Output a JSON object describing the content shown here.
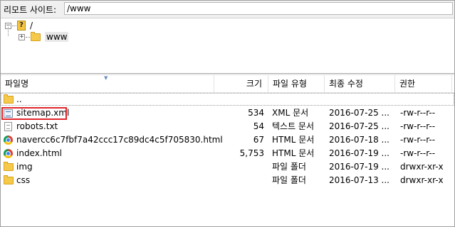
{
  "remote_site": {
    "label": "리모트 사이트:",
    "path": "/www"
  },
  "tree": {
    "root": {
      "toggle": "−",
      "label": "/"
    },
    "child": {
      "toggle": "+",
      "label": "www"
    }
  },
  "columns": {
    "name": "파일명",
    "size": "크기",
    "type": "파일 유형",
    "modified": "최종 수정",
    "perm": "권한"
  },
  "files": [
    {
      "icon": "folder-icon",
      "name": "..",
      "size": "",
      "type": "",
      "modified": "",
      "perm": ""
    },
    {
      "icon": "xml-file-icon",
      "name": "sitemap.xml",
      "size": "534",
      "type": "XML 문서",
      "modified": "2016-07-25 ...",
      "perm": "-rw-r--r--"
    },
    {
      "icon": "text-file-icon",
      "name": "robots.txt",
      "size": "54",
      "type": "텍스트 문서",
      "modified": "2016-07-25 ...",
      "perm": "-rw-r--r--"
    },
    {
      "icon": "chrome-html-icon",
      "name": "navercc6c7fbf7a42ccc17c89dc4c5f705830.html",
      "size": "67",
      "type": "HTML 문서",
      "modified": "2016-07-18 ...",
      "perm": "-rw-r--r--"
    },
    {
      "icon": "chrome-html-icon",
      "name": "index.html",
      "size": "5,753",
      "type": "HTML 문서",
      "modified": "2016-07-19 ...",
      "perm": "-rw-r--r--"
    },
    {
      "icon": "folder-icon",
      "name": "img",
      "size": "",
      "type": "파일 폴더",
      "modified": "2016-07-19 ...",
      "perm": "drwxr-xr-x"
    },
    {
      "icon": "folder-icon",
      "name": "css",
      "size": "",
      "type": "파일 폴더",
      "modified": "2016-07-13 ...",
      "perm": "drwxr-xr-x"
    }
  ],
  "highlight_color": "#e0252b"
}
